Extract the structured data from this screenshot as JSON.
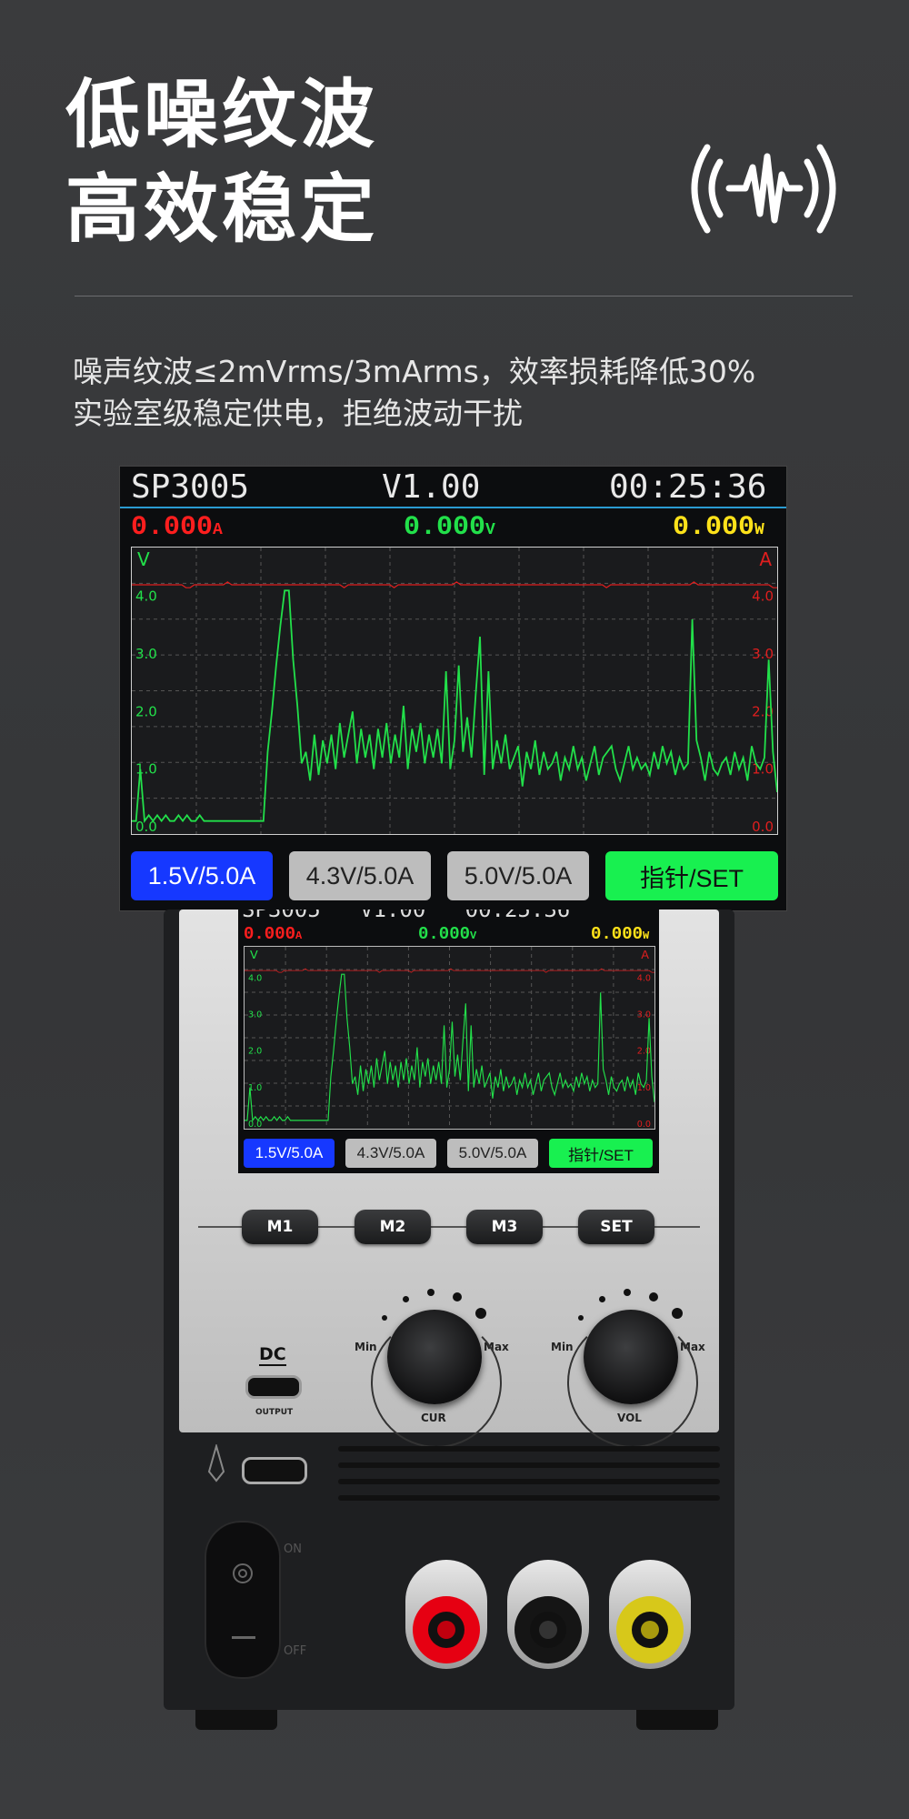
{
  "headline": {
    "line1": "低噪纹波",
    "line2": "高效稳定"
  },
  "description": {
    "line1": "噪声纹波≤2mVrms/3mArms，效率损耗降低30%",
    "line2": "实验室级稳定供电，拒绝波动干扰"
  },
  "icons": {
    "badge": "noise-wave-icon"
  },
  "screen": {
    "model": "SP3005",
    "version": "V1.00",
    "time": "00:25:36",
    "current": "0.000",
    "current_unit": "A",
    "voltage": "0.000",
    "voltage_unit": "V",
    "power": "0.000",
    "power_unit": "W",
    "axis_left_label": "V",
    "axis_right_label": "A",
    "left_ticks": [
      "4.0",
      "3.0",
      "2.0",
      "1.0",
      "0.0"
    ],
    "right_ticks": [
      "4.0",
      "3.0",
      "2.0",
      "1.0",
      "0.0"
    ],
    "presets": [
      "1.5V/5.0A",
      "4.3V/5.0A",
      "5.0V/5.0A"
    ],
    "set_button": "指针/SET",
    "colors": {
      "current": "#ff1e1e",
      "voltage": "#22e04a",
      "power": "#ffe21a",
      "preset_active": "#1638ff",
      "preset": "#bdbdbd",
      "set": "#18f050"
    }
  },
  "device_screen": {
    "top_fragment": "SP3005   V1.00   00:25:36"
  },
  "device": {
    "memory_buttons": [
      "M1",
      "M2",
      "M3",
      "SET"
    ],
    "knob_cur": {
      "min": "Min",
      "max": "Max",
      "name": "CUR"
    },
    "knob_vol": {
      "min": "Min",
      "max": "Max",
      "name": "VOL"
    },
    "dc_label": "DC",
    "output_label": "OUTPUT",
    "switch_on": "ON",
    "switch_off": "OFF"
  },
  "chart_data": {
    "type": "line",
    "ylim": [
      0,
      4.5
    ],
    "series": [
      {
        "color": "#22e04a",
        "axis": "left",
        "values": [
          0.1,
          0.1,
          1.0,
          0.1,
          0.2,
          0.1,
          0.2,
          0.1,
          0.2,
          0.1,
          0.1,
          0.2,
          0.1,
          0.2,
          0.1,
          0.1,
          0.2,
          0.1,
          0.1,
          0.1,
          0.1,
          0.1,
          0.1,
          0.1,
          0.1,
          0.1,
          0.1,
          0.1,
          0.1,
          0.1,
          0.1,
          0.1,
          1.3,
          2.0,
          2.8,
          3.5,
          4.1,
          4.1,
          2.9,
          2.1,
          1.1,
          1.3,
          0.8,
          1.6,
          0.9,
          1.5,
          1.1,
          1.6,
          1.0,
          1.8,
          1.2,
          1.6,
          2.0,
          1.1,
          1.7,
          1.2,
          1.6,
          1.0,
          1.7,
          1.2,
          1.8,
          1.1,
          1.6,
          1.2,
          2.1,
          1.0,
          1.7,
          1.3,
          1.8,
          1.1,
          1.6,
          1.2,
          1.7,
          1.1,
          2.7,
          1.0,
          1.5,
          2.8,
          1.3,
          1.9,
          1.2,
          2.3,
          3.3,
          0.9,
          2.7,
          1.0,
          1.5,
          1.1,
          1.6,
          1.0,
          1.2,
          1.4,
          0.7,
          1.3,
          1.0,
          1.5,
          0.9,
          1.3,
          1.0,
          1.1,
          1.3,
          0.8,
          1.2,
          1.0,
          1.4,
          1.0,
          1.2,
          0.8,
          1.1,
          1.4,
          0.9,
          1.2,
          1.3,
          1.4,
          1.0,
          0.8,
          1.1,
          1.4,
          1.0,
          1.2,
          1.0,
          1.1,
          0.9,
          1.3,
          1.0,
          1.4,
          1.1,
          1.3,
          0.9,
          1.2,
          1.0,
          1.1,
          3.6,
          1.5,
          1.2,
          0.8,
          1.3,
          1.0,
          0.9,
          1.1,
          1.2,
          0.9,
          1.3,
          1.0,
          1.2,
          0.8,
          1.4,
          1.1,
          1.0,
          1.2,
          2.9,
          1.3,
          0.6
        ]
      },
      {
        "color": "#e01e1e",
        "axis": "right",
        "values": [
          4.2,
          4.2,
          4.2,
          4.2,
          4.2,
          4.2,
          4.2,
          4.2,
          4.2,
          4.2,
          4.2,
          4.2,
          4.2,
          4.15,
          4.15,
          4.2,
          4.2,
          4.2,
          4.2,
          4.2,
          4.2,
          4.2,
          4.2,
          4.25,
          4.2,
          4.2,
          4.2,
          4.2,
          4.2,
          4.2,
          4.2,
          4.2,
          4.2,
          4.2,
          4.2,
          4.2,
          4.2,
          4.2,
          4.2,
          4.2,
          4.2,
          4.2,
          4.2,
          4.2,
          4.2,
          4.2,
          4.2,
          4.2,
          4.2,
          4.2,
          4.2,
          4.15,
          4.2,
          4.2,
          4.2,
          4.2,
          4.2,
          4.2,
          4.2,
          4.2,
          4.2,
          4.2,
          4.2,
          4.15,
          4.2,
          4.2,
          4.2,
          4.2,
          4.2,
          4.2,
          4.2,
          4.2,
          4.2,
          4.2,
          4.2,
          4.2,
          4.2,
          4.2,
          4.25,
          4.2,
          4.2,
          4.2,
          4.2,
          4.2,
          4.2,
          4.2,
          4.2,
          4.2,
          4.2,
          4.2,
          4.2,
          4.2,
          4.2,
          4.2,
          4.2,
          4.2,
          4.2,
          4.2,
          4.2,
          4.2,
          4.2,
          4.2,
          4.2,
          4.2,
          4.2,
          4.2,
          4.2,
          4.2,
          4.2,
          4.2,
          4.2,
          4.2,
          4.2,
          4.2,
          4.15,
          4.2,
          4.2,
          4.2,
          4.2,
          4.2,
          4.2,
          4.2,
          4.2,
          4.2,
          4.2,
          4.2,
          4.2,
          4.2,
          4.2,
          4.2,
          4.2,
          4.2,
          4.2,
          4.2,
          4.2,
          4.25,
          4.2,
          4.2,
          4.2,
          4.2,
          4.2,
          4.2,
          4.2,
          4.2,
          4.2,
          4.2,
          4.2,
          4.2,
          4.2,
          4.2,
          4.2,
          4.2,
          4.2,
          4.2,
          4.15,
          4.15
        ]
      }
    ]
  }
}
